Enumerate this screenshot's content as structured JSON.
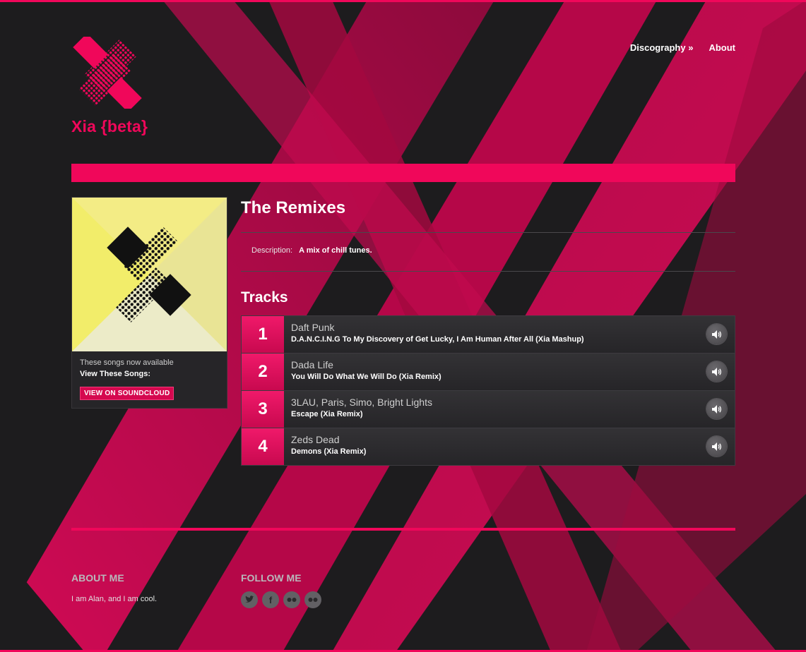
{
  "site": {
    "title": "Xia {beta}"
  },
  "nav": [
    {
      "label": "Discography »"
    },
    {
      "label": "About"
    }
  ],
  "album": {
    "title": "The Remixes",
    "description_label": "Description:",
    "description": "A mix of chill tunes.",
    "available_text": "These songs now available",
    "view_label": "View These Songs:",
    "soundcloud_button": "VIEW ON SOUNDCLOUD"
  },
  "tracks_heading": "Tracks",
  "tracks": [
    {
      "number": "1",
      "artist": "Daft Punk",
      "title": "D.A.N.C.I.N.G To My Discovery of Get Lucky, I Am Human After All (Xia Mashup)"
    },
    {
      "number": "2",
      "artist": "Dada Life",
      "title": "You Will Do What We Will Do (Xia Remix)"
    },
    {
      "number": "3",
      "artist": "3LAU, Paris, Simo, Bright Lights",
      "title": "Escape (Xia Remix)"
    },
    {
      "number": "4",
      "artist": "Zeds Dead",
      "title": "Demons (Xia Remix)"
    }
  ],
  "footer": {
    "about_heading": "ABOUT ME",
    "about_text": "I am Alan, and I am cool.",
    "follow_heading": "FOLLOW ME",
    "social_icons": [
      "twitter-icon",
      "facebook-icon",
      "flickr-icon",
      "flickr-icon"
    ]
  },
  "colors": {
    "accent": "#f0075a",
    "background": "#1d1c1e",
    "cover_bg": "#f3ec7e"
  }
}
